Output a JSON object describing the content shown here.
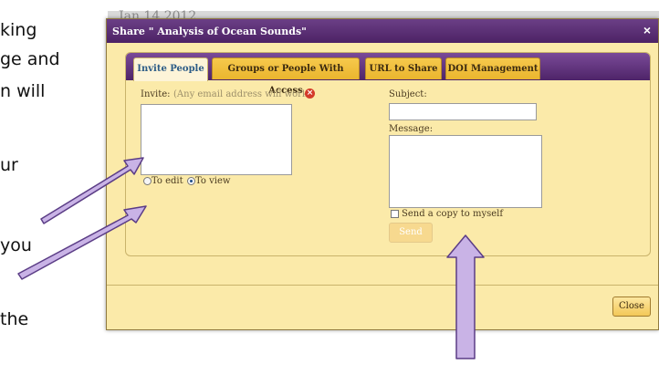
{
  "doc_fragments": [
    "king",
    "ge and",
    "n will",
    "ur",
    "you",
    "the"
  ],
  "background": {
    "date_text": "Jan 14 2012"
  },
  "dialog": {
    "title": "Share \" Analysis of Ocean Sounds\"",
    "close_symbol": "×",
    "tabs": [
      {
        "label": "Invite People",
        "active": true
      },
      {
        "label": "Groups or People With Access",
        "active": false
      },
      {
        "label": "URL to Share",
        "active": false
      },
      {
        "label": "DOI Management",
        "active": false
      }
    ],
    "invite": {
      "label": "Invite:",
      "hint": "(Any email address will work)",
      "error_icon": "error-icon",
      "value": ""
    },
    "permissions": {
      "options": [
        {
          "label": "To edit",
          "selected": false
        },
        {
          "label": "To view",
          "selected": true
        }
      ]
    },
    "subject": {
      "label": "Subject:",
      "value": ""
    },
    "message": {
      "label": "Message:",
      "value": ""
    },
    "copy_to_self": {
      "label": "Send a copy to myself",
      "checked": false
    },
    "send_label": "Send",
    "close_label": "Close"
  }
}
